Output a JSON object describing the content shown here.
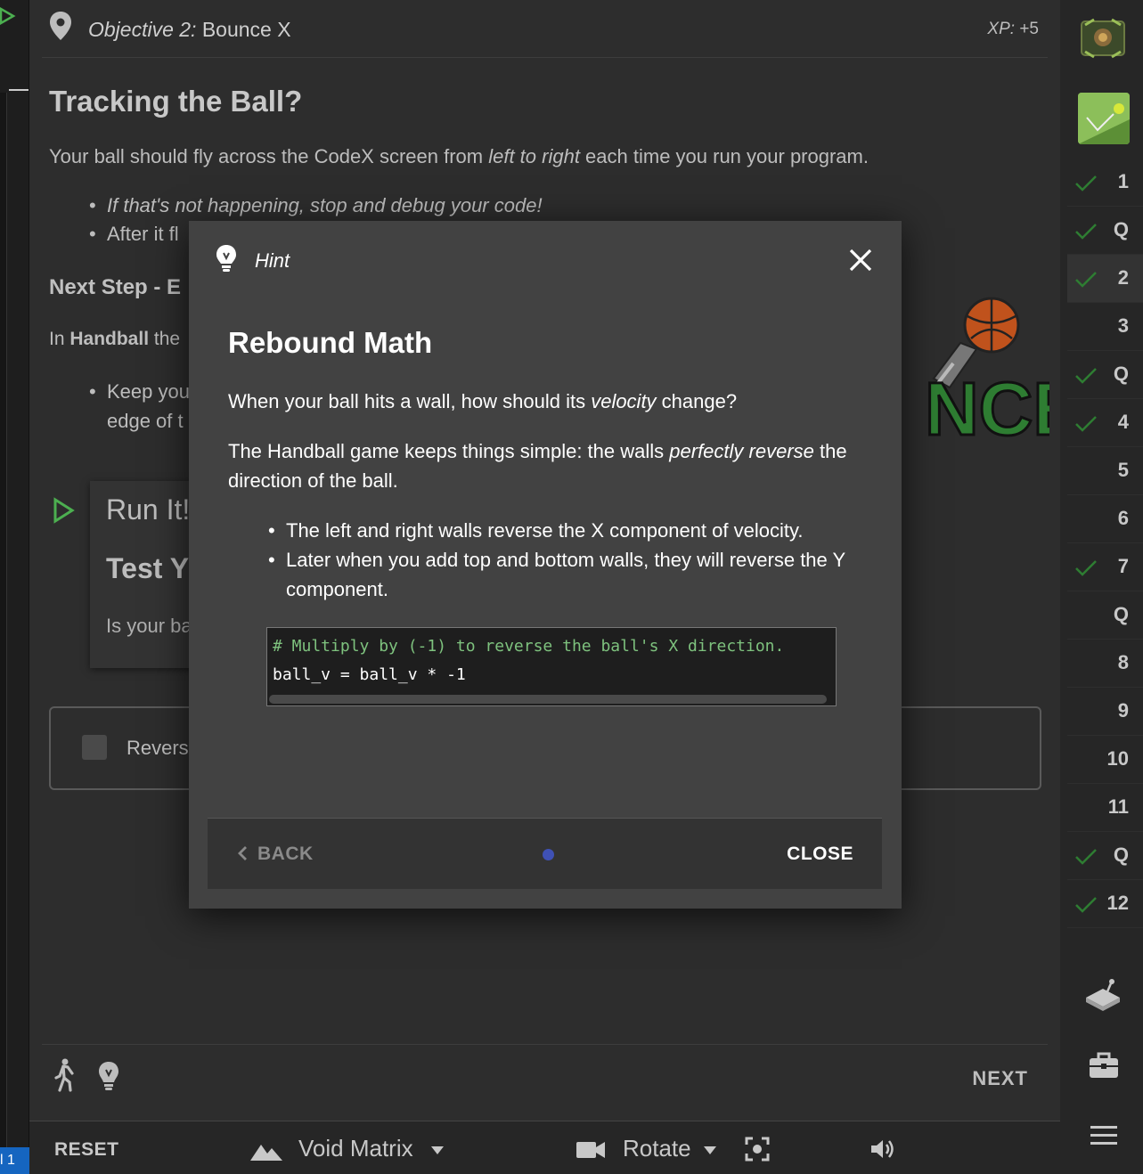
{
  "objective": {
    "prefix": "Objective 2:",
    "name": "Bounce X",
    "xp_label": "XP:",
    "xp_value": "+5"
  },
  "content": {
    "title": "Tracking the Ball?",
    "lead_1": "Your ball should fly across the CodeX screen from ",
    "lead_em": "left to right",
    "lead_2": " each time you run your program.",
    "bullets1": [
      "If that's not happening, stop and debug your code!",
      "After it fl"
    ],
    "next_step": "Next Step - E",
    "handball_prefix": "In ",
    "handball_bold": "Handball",
    "handball_rest": " the",
    "bullets2": [
      "Keep you",
      "edge of t"
    ],
    "run_it": "Run It!",
    "test_title": "Test Y",
    "is_your": "Is your ba",
    "checkbox_label": "Revers"
  },
  "footer": {
    "next": "NEXT"
  },
  "toolbar": {
    "reset": "RESET",
    "world": "Void Matrix",
    "rotate": "Rotate"
  },
  "left_strip": {
    "tab_label": "l 1"
  },
  "steps": [
    {
      "label": "1",
      "done": true,
      "active": false
    },
    {
      "label": "Q",
      "done": true,
      "active": false
    },
    {
      "label": "2",
      "done": true,
      "active": true
    },
    {
      "label": "3",
      "done": false,
      "active": false
    },
    {
      "label": "Q",
      "done": true,
      "active": false
    },
    {
      "label": "4",
      "done": true,
      "active": false
    },
    {
      "label": "5",
      "done": false,
      "active": false
    },
    {
      "label": "6",
      "done": false,
      "active": false
    },
    {
      "label": "7",
      "done": true,
      "active": false
    },
    {
      "label": "Q",
      "done": false,
      "active": false
    },
    {
      "label": "8",
      "done": false,
      "active": false
    },
    {
      "label": "9",
      "done": false,
      "active": false
    },
    {
      "label": "10",
      "done": false,
      "active": false
    },
    {
      "label": "11",
      "done": false,
      "active": false
    },
    {
      "label": "Q",
      "done": true,
      "active": false
    },
    {
      "label": "12",
      "done": true,
      "active": false
    }
  ],
  "modal": {
    "type": "Hint",
    "title": "Rebound Math",
    "p1_a": "When your ball hits a wall, how should its ",
    "p1_em": "velocity",
    "p1_b": " change?",
    "p2_a": "The Handball game keeps things simple: the walls ",
    "p2_em": "perfectly reverse",
    "p2_b": " the direction of the ball.",
    "bullets": [
      "The left and right walls reverse the X component of velocity.",
      "Later when you add top and bottom walls, they will reverse the Y component."
    ],
    "code_comment": "# Multiply by (-1) to reverse the ball's X direction.",
    "code_line": "ball_v = ball_v * -1",
    "back": "BACK",
    "close": "CLOSE"
  },
  "colors": {
    "accent": "#3f51b5",
    "check": "#2e7d32",
    "run_green": "#4caf50"
  },
  "icons": [
    "map-pin-icon",
    "lightbulb-icon",
    "close-icon",
    "walk-icon",
    "mountain-icon",
    "camera-icon",
    "focus-icon",
    "volume-icon",
    "gamepad-icon",
    "briefcase-icon",
    "menu-icon",
    "chevron-left-icon",
    "check-icon",
    "play-icon"
  ]
}
